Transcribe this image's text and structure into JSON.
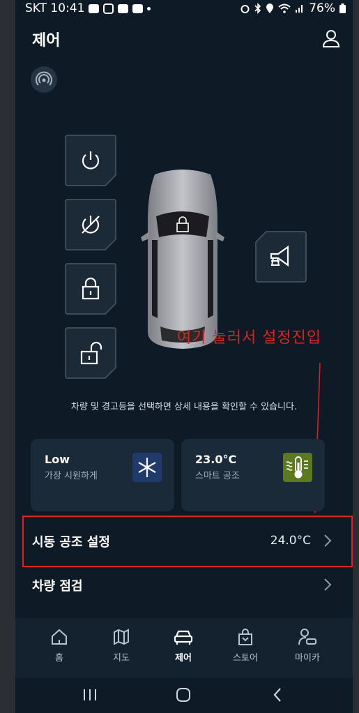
{
  "status_bar": {
    "carrier_time": "SKT 10:41",
    "app_icons": [
      "talk-icon",
      "instagram-icon",
      "youtube-icon",
      "youtube-icon"
    ],
    "battery": "76%",
    "system_icons": [
      "alarm-icon",
      "bluetooth-icon",
      "location-icon",
      "wifi-icon",
      "signal-icon",
      "battery-icon"
    ]
  },
  "header": {
    "title": "제어",
    "user_icon": "user-icon"
  },
  "remote_icon": "remote-signal-icon",
  "controls": [
    {
      "name": "engine-start",
      "icon": "power-icon"
    },
    {
      "name": "engine-stop",
      "icon": "power-off-icon"
    },
    {
      "name": "door-lock",
      "icon": "lock-icon"
    },
    {
      "name": "door-unlock",
      "icon": "unlock-icon"
    },
    {
      "name": "horn-light",
      "icon": "horn-icon"
    }
  ],
  "car": {
    "icon": "lock-icon"
  },
  "annotation": {
    "text": "여기 눌러서 설정진입",
    "color": "#e32020"
  },
  "hint": "차량 및 경고등을 선택하면 상세 내용을 확인할 수 있습니다.",
  "cards": [
    {
      "title": "Low",
      "subtitle": "가장 시원하게",
      "icon": "snowflake-icon",
      "icon_bg": "#1f3a6b"
    },
    {
      "title": "23.0°C",
      "subtitle": "스마트 공조",
      "icon": "thermometer-icon",
      "icon_bg": "#5c7a1d"
    }
  ],
  "rows": [
    {
      "label": "시동 공조 설정",
      "value": "24.0°C"
    },
    {
      "label": "차량 점검",
      "value": ""
    }
  ],
  "nav": {
    "active": "제어",
    "items": [
      {
        "label": "홈",
        "icon": "home-icon"
      },
      {
        "label": "지도",
        "icon": "map-icon"
      },
      {
        "label": "제어",
        "icon": "car-icon"
      },
      {
        "label": "스토어",
        "icon": "shopping-bag-icon"
      },
      {
        "label": "마이카",
        "icon": "my-car-icon"
      }
    ]
  },
  "system_nav": [
    "recents-icon",
    "home-circle-icon",
    "back-icon"
  ],
  "colors": {
    "background": "#0e1b26",
    "card": "#1a2a38",
    "annotation": "#e32020"
  }
}
